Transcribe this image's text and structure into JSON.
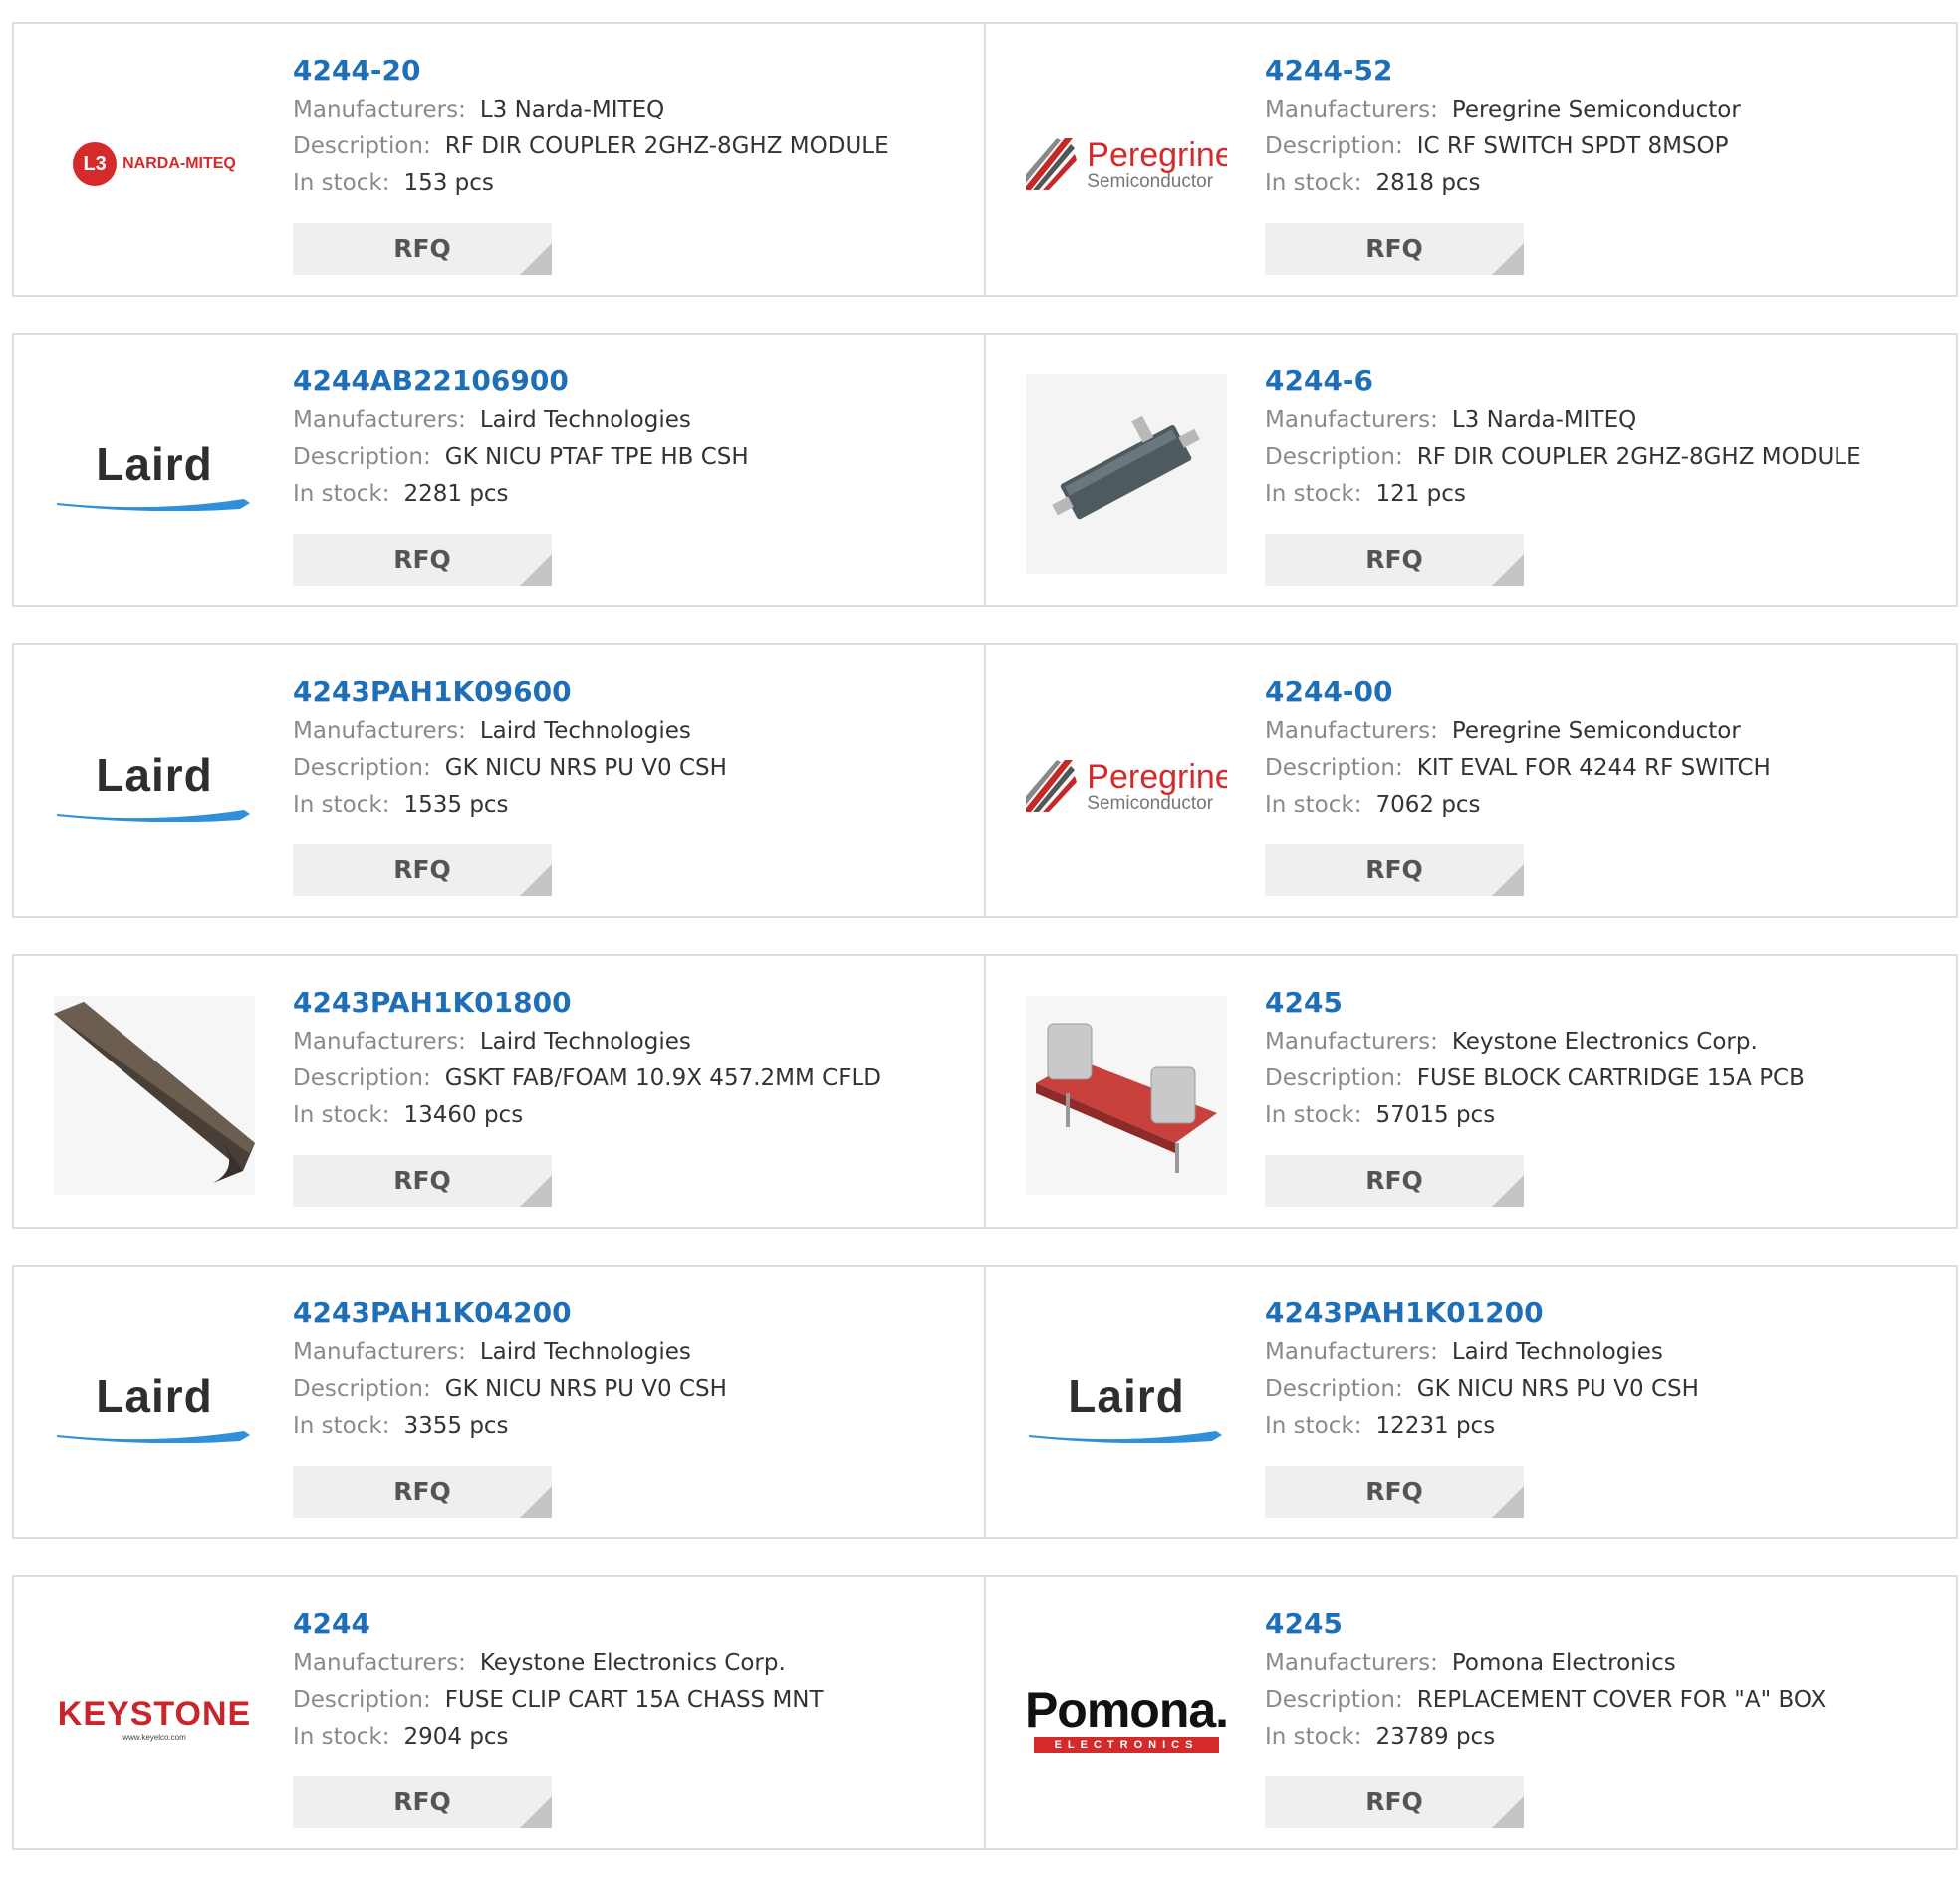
{
  "labels": {
    "manufacturer": "Manufacturers:",
    "description": "Description:",
    "stock": "In stock:",
    "rfq": "RFQ"
  },
  "products": [
    {
      "part": "4244-20",
      "manufacturer": "L3 Narda-MITEQ",
      "description": "RF DIR COUPLER 2GHZ-8GHZ MODULE",
      "stock": "153 pcs",
      "logo": "l3-narda-miteq-logo",
      "logo_text": "NARDA-MITEQ",
      "logo_badge": "3"
    },
    {
      "part": "4244-52",
      "manufacturer": "Peregrine Semiconductor",
      "description": "IC RF SWITCH SPDT 8MSOP",
      "stock": "2818 pcs",
      "logo": "peregrine-semiconductor-logo",
      "logo_text": "Peregrine",
      "logo_sub": "Semiconductor"
    },
    {
      "part": "4244AB22106900",
      "manufacturer": "Laird Technologies",
      "description": "GK NICU PTAF TPE HB CSH",
      "stock": "2281 pcs",
      "logo": "laird-logo",
      "logo_text": "Laird"
    },
    {
      "part": "4244-6",
      "manufacturer": "L3 Narda-MITEQ",
      "description": "RF DIR COUPLER 2GHZ-8GHZ MODULE",
      "stock": "121 pcs",
      "logo": "rf-coupler-photo"
    },
    {
      "part": "4243PAH1K09600",
      "manufacturer": "Laird Technologies",
      "description": "GK NICU NRS PU V0 CSH",
      "stock": "1535 pcs",
      "logo": "laird-logo",
      "logo_text": "Laird"
    },
    {
      "part": "4244-00",
      "manufacturer": "Peregrine Semiconductor",
      "description": "KIT EVAL FOR 4244 RF SWITCH",
      "stock": "7062 pcs",
      "logo": "peregrine-semiconductor-logo",
      "logo_text": "Peregrine",
      "logo_sub": "Semiconductor"
    },
    {
      "part": "4243PAH1K01800",
      "manufacturer": "Laird Technologies",
      "description": "GSKT FAB/FOAM 10.9X 457.2MM CFLD",
      "stock": "13460 pcs",
      "logo": "gasket-photo"
    },
    {
      "part": "4245",
      "manufacturer": "Keystone Electronics Corp.",
      "description": "FUSE BLOCK CARTRIDGE 15A PCB",
      "stock": "57015 pcs",
      "logo": "fuse-block-photo"
    },
    {
      "part": "4243PAH1K04200",
      "manufacturer": "Laird Technologies",
      "description": "GK NICU NRS PU V0 CSH",
      "stock": "3355 pcs",
      "logo": "laird-logo",
      "logo_text": "Laird"
    },
    {
      "part": "4243PAH1K01200",
      "manufacturer": "Laird Technologies",
      "description": "GK NICU NRS PU V0 CSH",
      "stock": "12231 pcs",
      "logo": "laird-logo",
      "logo_text": "Laird"
    },
    {
      "part": "4244",
      "manufacturer": "Keystone Electronics Corp.",
      "description": "FUSE CLIP CART 15A CHASS MNT",
      "stock": "2904 pcs",
      "logo": "keystone-logo",
      "logo_text": "KEYSTONE",
      "logo_sub": "www.keyelco.com"
    },
    {
      "part": "4245",
      "manufacturer": "Pomona Electronics",
      "description": "REPLACEMENT COVER FOR \"A\" BOX",
      "stock": "23789 pcs",
      "logo": "pomona-electronics-logo",
      "logo_text": "Pomona.",
      "logo_sub": "ELECTRONICS"
    }
  ]
}
